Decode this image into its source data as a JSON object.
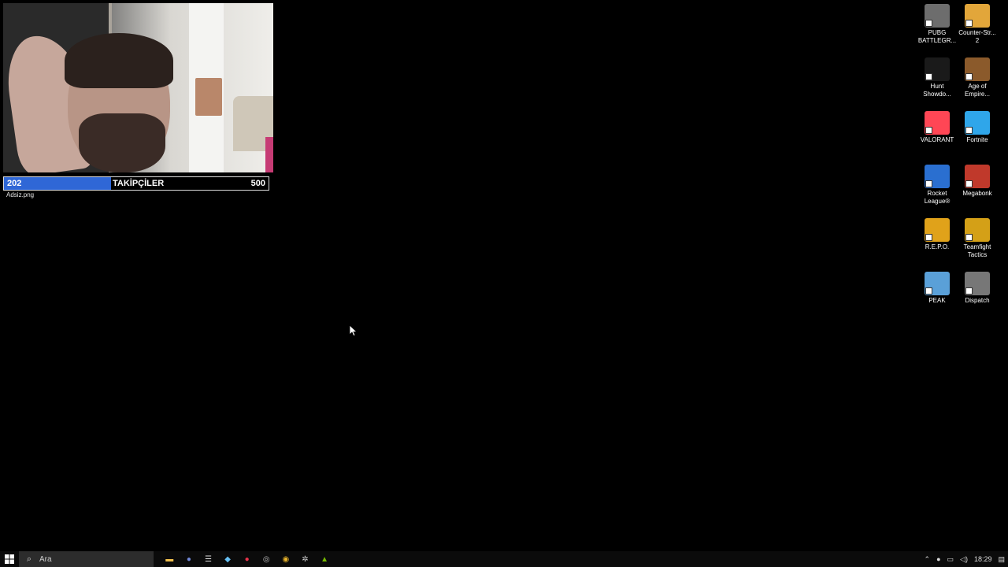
{
  "webcam": {
    "caption": "Adsiz.png"
  },
  "followers": {
    "current": "202",
    "label": "TAKİPÇİLER",
    "goal": "500",
    "progress": 0.404,
    "fill_color": "#2f67d6"
  },
  "desktop_icons": [
    {
      "label": "PUBG BATTLEGR...",
      "icon": "pubg-icon",
      "color": "#6d6d6d"
    },
    {
      "label": "Counter-Str... 2",
      "icon": "counter-strike-icon",
      "color": "#e2a63a"
    },
    {
      "label": "Hunt Showdo...",
      "icon": "hunt-showdown-icon",
      "color": "#1a1a1a"
    },
    {
      "label": "Age of Empire...",
      "icon": "age-of-empires-icon",
      "color": "#8b5a2b"
    },
    {
      "label": "VALORANT",
      "icon": "valorant-icon",
      "color": "#ff4655"
    },
    {
      "label": "Fortnite",
      "icon": "fortnite-icon",
      "color": "#2fa6ea"
    },
    {
      "label": "Rocket League®",
      "icon": "rocket-league-icon",
      "color": "#2a6fd0"
    },
    {
      "label": "Megabonk",
      "icon": "megabonk-icon",
      "color": "#c0392b"
    },
    {
      "label": "R.E.P.O.",
      "icon": "repo-icon",
      "color": "#e0a21a"
    },
    {
      "label": "Teamfight Tactics",
      "icon": "teamfight-tactics-icon",
      "color": "#d4a017"
    },
    {
      "label": "PEAK",
      "icon": "peak-icon",
      "color": "#5aa0d8"
    },
    {
      "label": "Dispatch",
      "icon": "dispatch-icon",
      "color": "#777777"
    }
  ],
  "taskbar": {
    "search_placeholder": "Ara",
    "apps": [
      {
        "icon": "file-explorer-icon",
        "glyph": "▬",
        "color": "#f2c14e"
      },
      {
        "icon": "discord-icon",
        "glyph": "●",
        "color": "#7289da"
      },
      {
        "icon": "epic-games-icon",
        "glyph": "☰",
        "color": "#dddddd"
      },
      {
        "icon": "steam-icon",
        "glyph": "◆",
        "color": "#66c0f4"
      },
      {
        "icon": "record-icon",
        "glyph": "●",
        "color": "#e8334a"
      },
      {
        "icon": "obs-icon",
        "glyph": "◎",
        "color": "#bbbbbb"
      },
      {
        "icon": "chrome-icon",
        "glyph": "◉",
        "color": "#e8b32a"
      },
      {
        "icon": "settings-icon",
        "glyph": "✲",
        "color": "#cccccc"
      },
      {
        "icon": "nvidia-icon",
        "glyph": "▲",
        "color": "#76b900"
      }
    ],
    "clock": "18:29"
  }
}
